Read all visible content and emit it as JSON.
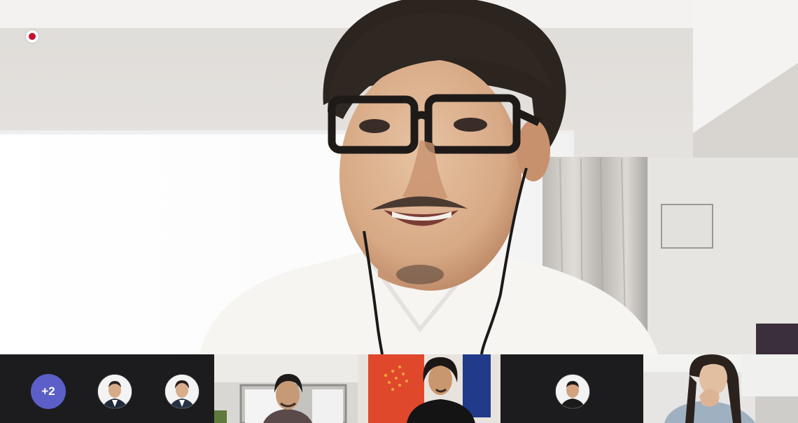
{
  "call": {
    "recording_color": "#c8102e"
  },
  "main_video": {
    "icon": "recording-dot-icon"
  },
  "participants": {
    "overflow_badge": "+2",
    "overflow_color": "#5b5fc7",
    "tiles": [
      {
        "kind": "avatar-group",
        "icon": "people-avatars"
      },
      {
        "kind": "video",
        "icon": "participant-video"
      },
      {
        "kind": "video",
        "icon": "participant-video"
      },
      {
        "kind": "avatar",
        "icon": "participant-avatar"
      },
      {
        "kind": "video",
        "icon": "participant-video"
      }
    ]
  }
}
